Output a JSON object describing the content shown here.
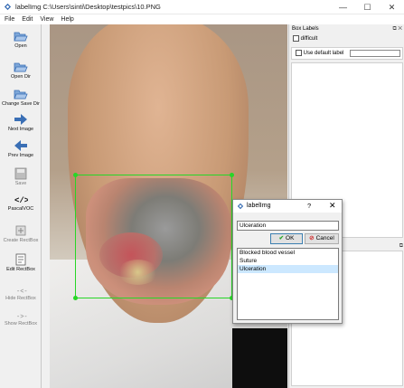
{
  "window": {
    "title": "labelImg C:\\Users\\sinti\\Desktop\\testpics\\10.PNG",
    "minimize": "—",
    "maximize": "☐",
    "close": "✕"
  },
  "menu": [
    "File",
    "Edit",
    "View",
    "Help"
  ],
  "toolbar": [
    {
      "label": "Open",
      "icon": "folder-open-icon",
      "enabled": true
    },
    {
      "label": "Open Dir",
      "icon": "folder-open-icon",
      "enabled": true
    },
    {
      "label": "Change Save Dir",
      "icon": "folder-open-icon",
      "enabled": true
    },
    {
      "label": "Next Image",
      "icon": "arrow-right-icon",
      "enabled": true
    },
    {
      "label": "Prev Image",
      "icon": "arrow-left-icon",
      "enabled": true
    },
    {
      "label": "Save",
      "icon": "save-icon",
      "enabled": false
    },
    {
      "label": "PascalVOC",
      "icon": "code-icon",
      "enabled": true
    },
    {
      "label": "Create RectBox",
      "icon": "create-rect-icon",
      "enabled": false
    },
    {
      "label": "Edit RectBox",
      "icon": "edit-rect-icon",
      "enabled": true
    },
    {
      "label": "Hide RectBox",
      "icon": "hide-icon",
      "enabled": false
    },
    {
      "label": "Show RectBox",
      "icon": "show-icon",
      "enabled": false
    }
  ],
  "box_labels": {
    "title": "Box Labels",
    "difficult": "difficult",
    "use_default": "Use default label",
    "default_value": ""
  },
  "dialog": {
    "title": "labelImg",
    "help": "?",
    "close": "✕",
    "input_value": "Ulceration",
    "ok": "OK",
    "cancel": "Cancel",
    "items": [
      "Blocked blood vessel",
      "Suture",
      "Ulceration"
    ],
    "selected_index": 2
  },
  "colors": {
    "bbox": "#27d627",
    "selection": "#cce8ff",
    "icon_blue": "#3a6fb5"
  }
}
